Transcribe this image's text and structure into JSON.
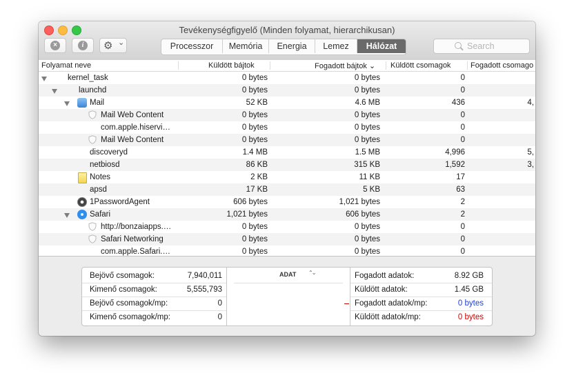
{
  "window": {
    "title": "Tevékenységfigyelő (Minden folyamat, hierarchikusan)",
    "search_placeholder": "Search",
    "stop_icon": "×",
    "info_icon": "i",
    "gear_icon": "⚙",
    "gear_chevron": "⌄"
  },
  "tabs": [
    "Processzor",
    "Memória",
    "Energia",
    "Lemez",
    "Hálózat"
  ],
  "active_tab": "Hálózat",
  "columns": {
    "name": "Folyamat neve",
    "sent_bytes": "Küldött bájtok",
    "received_bytes": "Fogadott bájtok",
    "sort_indicator": "⌄",
    "sent_packets": "Küldött csomagok",
    "received_packets": "Fogadott csomago"
  },
  "rows": [
    {
      "name": "kernel_task",
      "sent": "0 bytes",
      "recv": "0 bytes",
      "spk": "0",
      "rpk": ""
    },
    {
      "name": "launchd",
      "sent": "0 bytes",
      "recv": "0 bytes",
      "spk": "0",
      "rpk": ""
    },
    {
      "name": "Mail",
      "sent": "52 KB",
      "recv": "4.6 MB",
      "spk": "436",
      "rpk": "4,"
    },
    {
      "name": "Mail Web Content",
      "sent": "0 bytes",
      "recv": "0 bytes",
      "spk": "0",
      "rpk": ""
    },
    {
      "name": "com.apple.hiservi…",
      "sent": "0 bytes",
      "recv": "0 bytes",
      "spk": "0",
      "rpk": ""
    },
    {
      "name": "Mail Web Content",
      "sent": "0 bytes",
      "recv": "0 bytes",
      "spk": "0",
      "rpk": ""
    },
    {
      "name": "discoveryd",
      "sent": "1.4 MB",
      "recv": "1.5 MB",
      "spk": "4,996",
      "rpk": "5,"
    },
    {
      "name": "netbiosd",
      "sent": "86 KB",
      "recv": "315 KB",
      "spk": "1,592",
      "rpk": "3,"
    },
    {
      "name": "Notes",
      "sent": "2 KB",
      "recv": "11 KB",
      "spk": "17",
      "rpk": ""
    },
    {
      "name": "apsd",
      "sent": "17 KB",
      "recv": "5 KB",
      "spk": "63",
      "rpk": ""
    },
    {
      "name": "1PasswordAgent",
      "sent": "606 bytes",
      "recv": "1,021 bytes",
      "spk": "2",
      "rpk": ""
    },
    {
      "name": "Safari",
      "sent": "1,021 bytes",
      "recv": "606 bytes",
      "spk": "2",
      "rpk": ""
    },
    {
      "name": "http://bonzaiapps.…",
      "sent": "0 bytes",
      "recv": "0 bytes",
      "spk": "0",
      "rpk": ""
    },
    {
      "name": "Safari Networking",
      "sent": "0 bytes",
      "recv": "0 bytes",
      "spk": "0",
      "rpk": ""
    },
    {
      "name": "com.apple.Safari.…",
      "sent": "0 bytes",
      "recv": "0 bytes",
      "spk": "0",
      "rpk": ""
    }
  ],
  "summary": {
    "left": [
      {
        "label": "Bejövő csomagok:",
        "value": "7,940,011"
      },
      {
        "label": "Kimenő csomagok:",
        "value": "5,555,793"
      },
      {
        "label": "Bejövő csomagok/mp:",
        "value": "0"
      },
      {
        "label": "Kimenő csomagok/mp:",
        "value": "0"
      }
    ],
    "graph_label": "ADAT",
    "graph_chevron": "⌃⌄",
    "right": [
      {
        "label": "Fogadott adatok:",
        "value": "8.92 GB"
      },
      {
        "label": "Küldött adatok:",
        "value": "1.45 GB"
      },
      {
        "label": "Fogadott adatok/mp:",
        "value": "0 bytes"
      },
      {
        "label": "Küldött adatok/mp:",
        "value": "0 bytes"
      }
    ]
  },
  "colors": {
    "received_rate": "#1a3fd8",
    "sent_rate": "#d40000",
    "active_tab_bg": "#6a6a6a"
  }
}
